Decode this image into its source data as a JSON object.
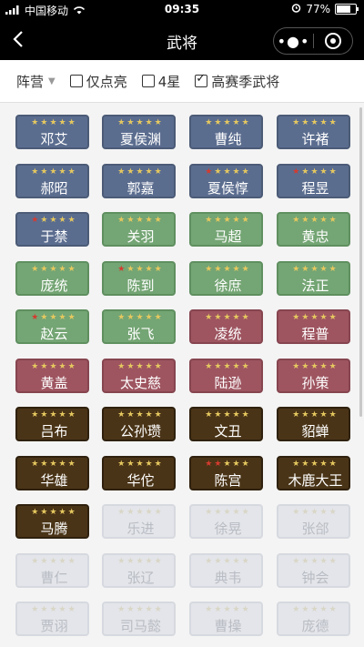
{
  "status_bar": {
    "carrier": "中国移动",
    "time": "09:35",
    "battery_percent": "77%",
    "battery_level": 0.77
  },
  "nav": {
    "title": "武将",
    "back_icon": "back-arrow-icon",
    "more_icon": "more-dots-icon",
    "close_icon": "target-icon"
  },
  "filters": {
    "camp_label": "阵营",
    "options": [
      {
        "label": "仅点亮",
        "checked": false
      },
      {
        "label": "4星",
        "checked": false
      },
      {
        "label": "高赛季武将",
        "checked": true
      }
    ]
  },
  "palette": {
    "blue": "#5b6d8f",
    "green": "#74a574",
    "red": "#9e5560",
    "dark": "#4a3417",
    "gray": "#e3e5ea",
    "star": "#e5c85f",
    "star_red": "#d43b2f"
  },
  "generals": [
    {
      "name": "邓艾",
      "color": "blue",
      "red_stars": 0
    },
    {
      "name": "夏侯渊",
      "color": "blue",
      "red_stars": 0
    },
    {
      "name": "曹纯",
      "color": "blue",
      "red_stars": 0
    },
    {
      "name": "许褚",
      "color": "blue",
      "red_stars": 0
    },
    {
      "name": "郝昭",
      "color": "blue",
      "red_stars": 0
    },
    {
      "name": "郭嘉",
      "color": "blue",
      "red_stars": 0
    },
    {
      "name": "夏侯惇",
      "color": "blue",
      "red_stars": 1
    },
    {
      "name": "程昱",
      "color": "blue",
      "red_stars": 1
    },
    {
      "name": "于禁",
      "color": "blue",
      "red_stars": 1
    },
    {
      "name": "关羽",
      "color": "green",
      "red_stars": 0
    },
    {
      "name": "马超",
      "color": "green",
      "red_stars": 0
    },
    {
      "name": "黄忠",
      "color": "green",
      "red_stars": 0
    },
    {
      "name": "庞统",
      "color": "green",
      "red_stars": 0
    },
    {
      "name": "陈到",
      "color": "green",
      "red_stars": 1
    },
    {
      "name": "徐庶",
      "color": "green",
      "red_stars": 0
    },
    {
      "name": "法正",
      "color": "green",
      "red_stars": 0
    },
    {
      "name": "赵云",
      "color": "green",
      "red_stars": 1
    },
    {
      "name": "张飞",
      "color": "green",
      "red_stars": 0
    },
    {
      "name": "凌统",
      "color": "red",
      "red_stars": 0
    },
    {
      "name": "程普",
      "color": "red",
      "red_stars": 0
    },
    {
      "name": "黄盖",
      "color": "red",
      "red_stars": 0
    },
    {
      "name": "太史慈",
      "color": "red",
      "red_stars": 0
    },
    {
      "name": "陆逊",
      "color": "red",
      "red_stars": 0
    },
    {
      "name": "孙策",
      "color": "red",
      "red_stars": 0
    },
    {
      "name": "吕布",
      "color": "dark",
      "red_stars": 0
    },
    {
      "name": "公孙瓒",
      "color": "dark",
      "red_stars": 0
    },
    {
      "name": "文丑",
      "color": "dark",
      "red_stars": 0
    },
    {
      "name": "貂蝉",
      "color": "dark",
      "red_stars": 0
    },
    {
      "name": "华雄",
      "color": "dark",
      "red_stars": 0
    },
    {
      "name": "华佗",
      "color": "dark",
      "red_stars": 0
    },
    {
      "name": "陈宫",
      "color": "dark",
      "red_stars": 2
    },
    {
      "name": "木鹿大王",
      "color": "dark",
      "red_stars": 0
    },
    {
      "name": "马腾",
      "color": "dark",
      "red_stars": 0
    },
    {
      "name": "乐进",
      "color": "gray",
      "red_stars": 0
    },
    {
      "name": "徐晃",
      "color": "gray",
      "red_stars": 0
    },
    {
      "name": "张郃",
      "color": "gray",
      "red_stars": 0
    },
    {
      "name": "曹仁",
      "color": "gray",
      "red_stars": 0
    },
    {
      "name": "张辽",
      "color": "gray",
      "red_stars": 0
    },
    {
      "name": "典韦",
      "color": "gray",
      "red_stars": 0
    },
    {
      "name": "钟会",
      "color": "gray",
      "red_stars": 0
    },
    {
      "name": "贾诩",
      "color": "gray",
      "red_stars": 0
    },
    {
      "name": "司马懿",
      "color": "gray",
      "red_stars": 0
    },
    {
      "name": "曹操",
      "color": "gray",
      "red_stars": 0
    },
    {
      "name": "庞德",
      "color": "gray",
      "red_stars": 0
    }
  ]
}
